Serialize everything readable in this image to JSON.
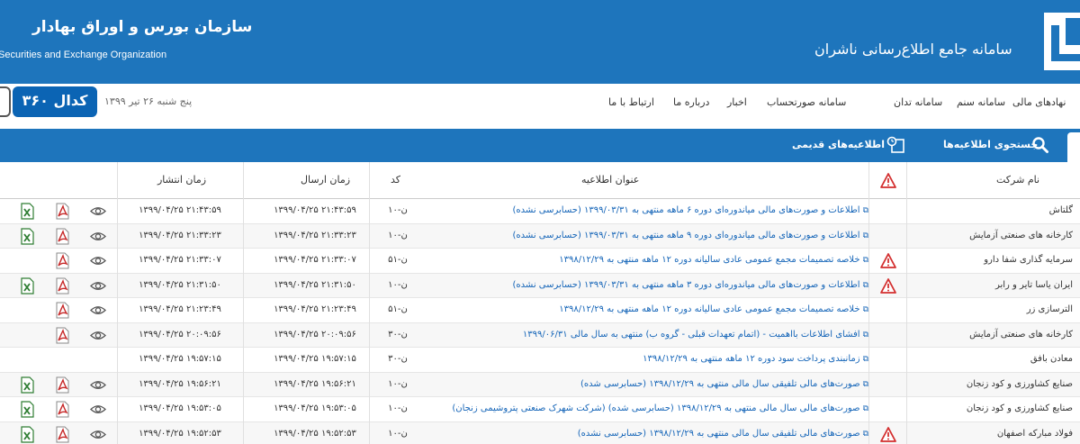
{
  "header": {
    "org_title": "سازمان بورس و اوراق بهادار",
    "org_subtitle": "Securities and Exchange Organization",
    "system_title": "سامانه جامع اطلاع‌رسانی ناشران"
  },
  "nav": {
    "menu": [
      "نهادهای مالی",
      "سامانه سنم",
      "سامانه تدان",
      "سامانه صورتحساب",
      "اخبار",
      "درباره ما",
      "ارتباط با ما"
    ],
    "date": "پنج شنبه ۲۶ تیر ۱۳۹۹",
    "badge": "کدال ۳۶۰"
  },
  "tabs": {
    "search_label": "جستجوی اطلاعیه‌ها",
    "old_label": "اطلاعیه‌های قدیمی"
  },
  "table": {
    "headers": {
      "company": "نام شرکت",
      "title": "عنوان اطلاعیه",
      "code": "کد",
      "sent": "زمان ارسال",
      "published": "زمان انتشار"
    },
    "rows": [
      {
        "company": "گلتاش",
        "warn": false,
        "title": "اطلاعات و صورت‌های مالی میاندوره‌ای دوره ۶ ماهه منتهی به ۱۳۹۹/۰۳/۳۱ (حسابرسی نشده)",
        "code": "ن-۱۰",
        "sent": "۱۳۹۹/۰۴/۲۵ ۲۱:۴۳:۵۹",
        "published": "۱۳۹۹/۰۴/۲۵ ۲۱:۴۳:۵۹",
        "eye": true,
        "pdf": true,
        "excel": true
      },
      {
        "company": "کارخانه های صنعتی آزمایش",
        "warn": false,
        "title": "اطلاعات و صورت‌های مالی میاندوره‌ای دوره ۹ ماهه منتهی به ۱۳۹۹/۰۳/۳۱ (حسابرسی نشده)",
        "code": "ن-۱۰",
        "sent": "۱۳۹۹/۰۴/۲۵ ۲۱:۳۳:۲۳",
        "published": "۱۳۹۹/۰۴/۲۵ ۲۱:۳۳:۲۳",
        "eye": true,
        "pdf": true,
        "excel": true
      },
      {
        "company": "سرمایه گذاری شفا دارو",
        "warn": true,
        "title": "خلاصه تصمیمات مجمع عمومی عادی سالیانه دوره ۱۲ ماهه منتهی به ۱۳۹۸/۱۲/۲۹",
        "code": "ن-۵۱",
        "sent": "۱۳۹۹/۰۴/۲۵ ۲۱:۳۳:۰۷",
        "published": "۱۳۹۹/۰۴/۲۵ ۲۱:۳۳:۰۷",
        "eye": true,
        "pdf": true,
        "excel": false
      },
      {
        "company": "ایران یاسا تایر و رابر",
        "warn": true,
        "title": "اطلاعات و صورت‌های مالی میاندوره‌ای دوره ۳ ماهه منتهی به ۱۳۹۹/۰۳/۳۱ (حسابرسی نشده)",
        "code": "ن-۱۰",
        "sent": "۱۳۹۹/۰۴/۲۵ ۲۱:۳۱:۵۰",
        "published": "۱۳۹۹/۰۴/۲۵ ۲۱:۳۱:۵۰",
        "eye": true,
        "pdf": true,
        "excel": true
      },
      {
        "company": "الترسازی زر",
        "warn": false,
        "title": "خلاصه تصمیمات مجمع عمومی عادی سالیانه دوره ۱۲ ماهه منتهی به ۱۳۹۸/۱۲/۲۹",
        "code": "ن-۵۱",
        "sent": "۱۳۹۹/۰۴/۲۵ ۲۱:۲۳:۴۹",
        "published": "۱۳۹۹/۰۴/۲۵ ۲۱:۲۳:۴۹",
        "eye": true,
        "pdf": true,
        "excel": false
      },
      {
        "company": "کارخانه های صنعتی آزمایش",
        "warn": false,
        "title": "افشای اطلاعات بااهمیت - (اتمام تعهدات قبلی - گروه ب) منتهی به سال مالی ۱۳۹۹/۰۶/۳۱",
        "code": "ن-۳۰",
        "sent": "۱۳۹۹/۰۴/۲۵ ۲۰:۰۹:۵۶",
        "published": "۱۳۹۹/۰۴/۲۵ ۲۰:۰۹:۵۶",
        "eye": true,
        "pdf": true,
        "excel": false
      },
      {
        "company": "معادن بافق",
        "warn": false,
        "title": "زمانبندی پرداخت سود دوره ۱۲ ماهه منتهی به ۱۳۹۸/۱۲/۲۹",
        "code": "ن-۳۰",
        "sent": "۱۳۹۹/۰۴/۲۵ ۱۹:۵۷:۱۵",
        "published": "۱۳۹۹/۰۴/۲۵ ۱۹:۵۷:۱۵",
        "eye": false,
        "pdf": false,
        "excel": false
      },
      {
        "company": "صنایع کشاورزی و کود زنجان",
        "warn": false,
        "title": "صورت‌های مالی تلفیقی سال مالی منتهی به ۱۳۹۸/۱۲/۲۹ (حسابرسی شده)",
        "code": "ن-۱۰",
        "sent": "۱۳۹۹/۰۴/۲۵ ۱۹:۵۶:۲۱",
        "published": "۱۳۹۹/۰۴/۲۵ ۱۹:۵۶:۲۱",
        "eye": true,
        "pdf": true,
        "excel": true
      },
      {
        "company": "صنایع کشاورزی و کود زنجان",
        "warn": false,
        "title": "صورت‌های مالی سال مالی منتهی به ۱۳۹۸/۱۲/۲۹ (حسابرسی شده) (شرکت شهرک صنعتی پتروشیمی زنجان)",
        "code": "ن-۱۰",
        "sent": "۱۳۹۹/۰۴/۲۵ ۱۹:۵۳:۰۵",
        "published": "۱۳۹۹/۰۴/۲۵ ۱۹:۵۳:۰۵",
        "eye": true,
        "pdf": true,
        "excel": true
      },
      {
        "company": "فولاد مبارکه اصفهان",
        "warn": true,
        "title": "صورت‌های مالی تلفیقی سال مالی منتهی به ۱۳۹۸/۱۲/۲۹ (حسابرسی نشده)",
        "code": "ن-۱۰",
        "sent": "۱۳۹۹/۰۴/۲۵ ۱۹:۵۲:۵۳",
        "published": "۱۳۹۹/۰۴/۲۵ ۱۹:۵۲:۵۳",
        "eye": true,
        "pdf": true,
        "excel": true
      }
    ]
  },
  "colors": {
    "header_blue": "#1e75bc",
    "link_blue": "#1565b8",
    "warn_red": "#d32f2f",
    "pdf_red": "#c62828",
    "excel_green": "#2e7d32"
  }
}
